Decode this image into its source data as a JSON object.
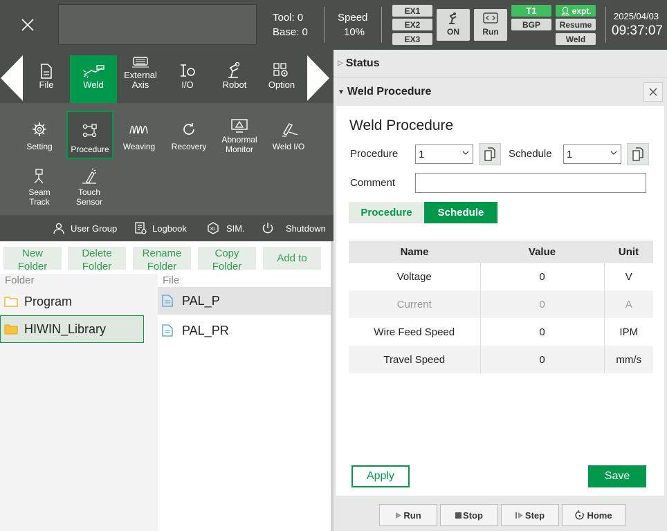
{
  "topbar": {
    "tool_label": "Tool: 0",
    "base_label": "Base: 0",
    "speed_label": "Speed",
    "speed_value": "10%",
    "ex1": "EX1",
    "ex2": "EX2",
    "ex3": "EX3",
    "on_label": "ON",
    "run_label": "Run",
    "mode": "T1",
    "bgp": "BGP",
    "user": "expt.",
    "resume": "Resume",
    "weld": "Weld",
    "date": "2025/04/03",
    "time": "09:37:07"
  },
  "nav": {
    "items": [
      {
        "label": "File",
        "icon": "file-icon"
      },
      {
        "label": "Weld",
        "icon": "weld-torch-icon"
      },
      {
        "label": "External Axis",
        "icon": "external-axis-icon"
      },
      {
        "label": "I/O",
        "icon": "io-icon"
      },
      {
        "label": "Robot",
        "icon": "robot-arm-icon"
      },
      {
        "label": "Option",
        "icon": "option-gear-icon"
      }
    ],
    "ext_line1": "External",
    "ext_line2": "Axis"
  },
  "sub": {
    "items": [
      {
        "label": "Setting",
        "icon": "gear-icon"
      },
      {
        "label": "Procedure",
        "icon": "procedure-icon"
      },
      {
        "label": "Weaving",
        "icon": "weaving-icon"
      },
      {
        "label": "Recovery",
        "icon": "refresh-icon"
      },
      {
        "label1": "Abnormal",
        "label2": "Monitor",
        "icon": "warning-monitor-icon"
      },
      {
        "label": "Weld I/O",
        "icon": "weld-io-icon"
      },
      {
        "label1": "Seam",
        "label2": "Track",
        "icon": "seam-track-icon"
      },
      {
        "label1": "Touch",
        "label2": "Sensor",
        "icon": "touch-sensor-icon"
      }
    ]
  },
  "util": {
    "user_group": "User Group",
    "logbook": "Logbook",
    "sim": "SIM.",
    "shutdown": "Shutdown"
  },
  "browser": {
    "buttons": [
      {
        "l1": "New",
        "l2": "Folder"
      },
      {
        "l1": "Delete",
        "l2": "Folder"
      },
      {
        "l1": "Rename",
        "l2": "Folder"
      },
      {
        "l1": "Copy",
        "l2": "Folder"
      },
      {
        "l1": "Add to",
        "l2": ""
      }
    ],
    "folder_header": "Folder",
    "file_header": "File",
    "folders": [
      "Program",
      "HIWIN_Library"
    ],
    "files": [
      "PAL_P",
      "PAL_PR"
    ]
  },
  "right": {
    "status": "Status",
    "weld_proc": "Weld Procedure",
    "title": "Weld Procedure",
    "procedure_label": "Procedure",
    "procedure_value": "1",
    "schedule_label": "Schedule",
    "schedule_value": "1",
    "comment_label": "Comment",
    "comment_value": "",
    "tab_procedure": "Procedure",
    "tab_schedule": "Schedule",
    "table": {
      "headers": [
        "Name",
        "Value",
        "Unit"
      ],
      "rows": [
        {
          "name": "Voltage",
          "value": "0",
          "unit": "V"
        },
        {
          "name": "Current",
          "value": "0",
          "unit": "A"
        },
        {
          "name": "Wire Feed Speed",
          "value": "0",
          "unit": "IPM"
        },
        {
          "name": "Travel Speed",
          "value": "0",
          "unit": "mm/s"
        }
      ]
    },
    "apply": "Apply",
    "save": "Save",
    "run": "Run",
    "stop": "Stop",
    "step": "Step",
    "home": "Home"
  },
  "colors": {
    "accent": "#00994c",
    "dark_bg": "#4b4f4b",
    "mode_green": "#3fbd5f"
  }
}
